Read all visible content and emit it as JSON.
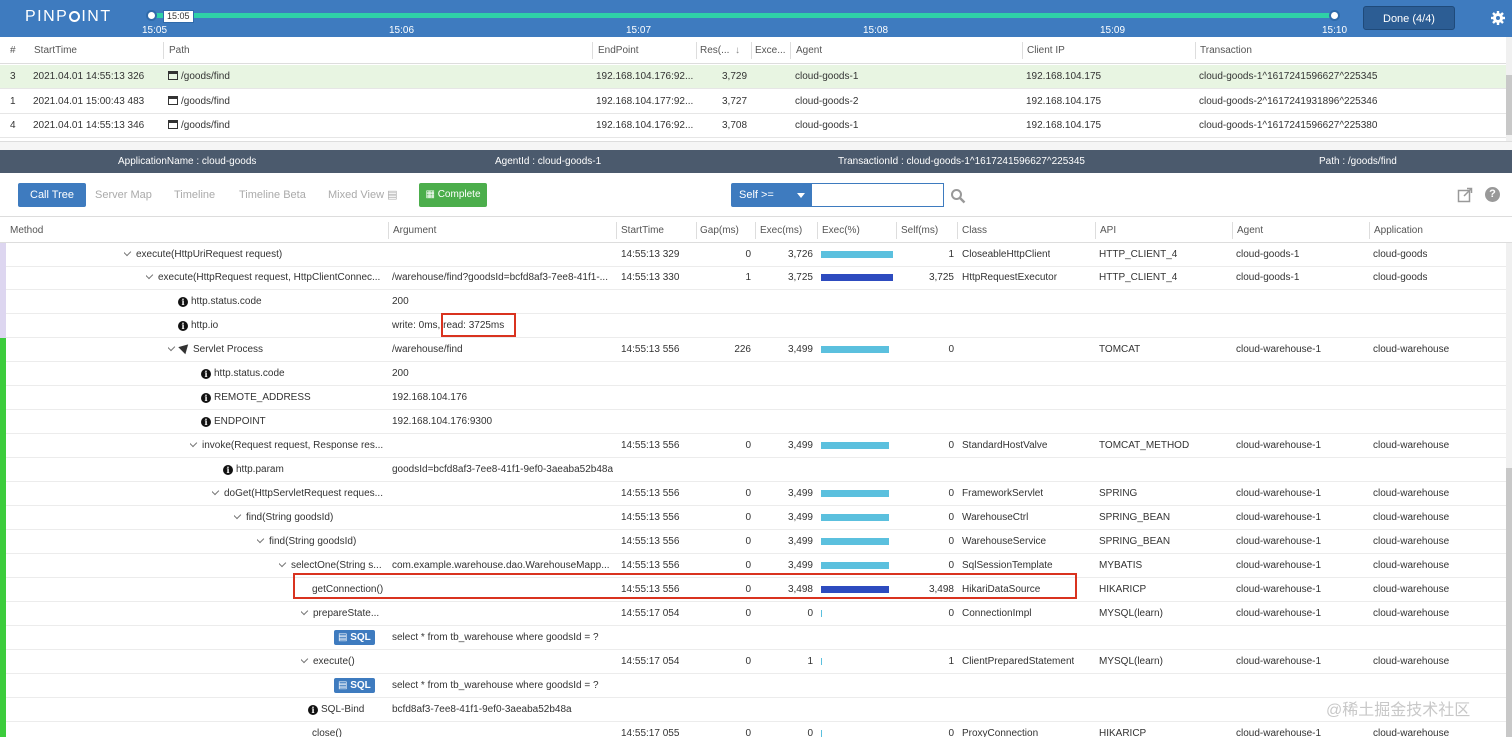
{
  "topbar": {
    "logo": [
      "PINP",
      "INT"
    ],
    "knob_time": "15:05",
    "ticks": [
      "15:05",
      "15:06",
      "15:07",
      "15:08",
      "15:09",
      "15:10"
    ],
    "done_label": "Done (4/4)"
  },
  "txlist": {
    "columns": [
      "#",
      "StartTime",
      "Path",
      "EndPoint",
      "Res(...",
      "Exce...",
      "Agent",
      "Client IP",
      "Transaction"
    ],
    "rows": [
      {
        "n": "3",
        "start": "2021.04.01 14:55:13 326",
        "path": "/goods/find",
        "endpoint": "192.168.104.176:92...",
        "res": "3,729",
        "agent": "cloud-goods-1",
        "client": "192.168.104.175",
        "tx": "cloud-goods-1^1617241596627^225345"
      },
      {
        "n": "1",
        "start": "2021.04.01 15:00:43 483",
        "path": "/goods/find",
        "endpoint": "192.168.104.177:92...",
        "res": "3,727",
        "agent": "cloud-goods-2",
        "client": "192.168.104.175",
        "tx": "cloud-goods-2^1617241931896^225346"
      },
      {
        "n": "4",
        "start": "2021.04.01 14:55:13 346",
        "path": "/goods/find",
        "endpoint": "192.168.104.176:92...",
        "res": "3,708",
        "agent": "cloud-goods-1",
        "client": "192.168.104.175",
        "tx": "cloud-goods-1^1617241596627^225380"
      }
    ]
  },
  "infobar": {
    "app": "ApplicationName : cloud-goods",
    "agent": "AgentId : cloud-goods-1",
    "tx": "TransactionId : cloud-goods-1^1617241596627^225345",
    "path": "Path : /goods/find"
  },
  "tabs": {
    "items": [
      "Call Tree",
      "Server Map",
      "Timeline",
      "Timeline Beta",
      "Mixed View"
    ],
    "complete": "Complete",
    "self_filter": "Self >="
  },
  "calltree": {
    "columns": [
      "Method",
      "Argument",
      "StartTime",
      "Gap(ms)",
      "Exec(ms)",
      "Exec(%)",
      "Self(ms)",
      "Class",
      "API",
      "Agent",
      "Application"
    ],
    "rows": [
      {
        "method": "execute(HttpUriRequest request)",
        "arg": "",
        "start": "14:55:13 329",
        "gap": "0",
        "exec": "3,726",
        "pct": 1.0,
        "self": "1",
        "cls": "CloseableHttpClient",
        "api": "HTTP_CLIENT_4",
        "agent": "cloud-goods-1",
        "app": "cloud-goods"
      },
      {
        "method": "execute(HttpRequest request, HttpClientConnec...",
        "arg": "/warehouse/find?goodsId=bcfd8af3-7ee8-41f1-...",
        "start": "14:55:13 330",
        "gap": "1",
        "exec": "3,725",
        "pct": 1.0,
        "self": "3,725",
        "cls": "HttpRequestExecutor",
        "api": "HTTP_CLIENT_4",
        "agent": "cloud-goods-1",
        "app": "cloud-goods"
      },
      {
        "method": "http.status.code",
        "arg": "200",
        "start": "",
        "gap": "",
        "exec": "",
        "pct": 0,
        "self": "",
        "cls": "",
        "api": "",
        "agent": "",
        "app": ""
      },
      {
        "method": "http.io",
        "arg": "write: 0ms, read: 3725ms",
        "start": "",
        "gap": "",
        "exec": "",
        "pct": 0,
        "self": "",
        "cls": "",
        "api": "",
        "agent": "",
        "app": ""
      },
      {
        "method": "Servlet Process",
        "arg": "/warehouse/find",
        "start": "14:55:13 556",
        "gap": "226",
        "exec": "3,499",
        "pct": 0.94,
        "self": "0",
        "cls": "",
        "api": "TOMCAT",
        "agent": "cloud-warehouse-1",
        "app": "cloud-warehouse"
      },
      {
        "method": "http.status.code",
        "arg": "200",
        "start": "",
        "gap": "",
        "exec": "",
        "pct": 0,
        "self": "",
        "cls": "",
        "api": "",
        "agent": "",
        "app": ""
      },
      {
        "method": "REMOTE_ADDRESS",
        "arg": "192.168.104.176",
        "start": "",
        "gap": "",
        "exec": "",
        "pct": 0,
        "self": "",
        "cls": "",
        "api": "",
        "agent": "",
        "app": ""
      },
      {
        "method": "ENDPOINT",
        "arg": "192.168.104.176:9300",
        "start": "",
        "gap": "",
        "exec": "",
        "pct": 0,
        "self": "",
        "cls": "",
        "api": "",
        "agent": "",
        "app": ""
      },
      {
        "method": "invoke(Request request, Response res...",
        "arg": "",
        "start": "14:55:13 556",
        "gap": "0",
        "exec": "3,499",
        "pct": 0.94,
        "self": "0",
        "cls": "StandardHostValve",
        "api": "TOMCAT_METHOD",
        "agent": "cloud-warehouse-1",
        "app": "cloud-warehouse"
      },
      {
        "method": "http.param",
        "arg": "goodsId=bcfd8af3-7ee8-41f1-9ef0-3aeaba52b48a",
        "start": "",
        "gap": "",
        "exec": "",
        "pct": 0,
        "self": "",
        "cls": "",
        "api": "",
        "agent": "",
        "app": ""
      },
      {
        "method": "doGet(HttpServletRequest reques...",
        "arg": "",
        "start": "14:55:13 556",
        "gap": "0",
        "exec": "3,499",
        "pct": 0.94,
        "self": "0",
        "cls": "FrameworkServlet",
        "api": "SPRING",
        "agent": "cloud-warehouse-1",
        "app": "cloud-warehouse"
      },
      {
        "method": "find(String goodsId)",
        "arg": "",
        "start": "14:55:13 556",
        "gap": "0",
        "exec": "3,499",
        "pct": 0.94,
        "self": "0",
        "cls": "WarehouseCtrl",
        "api": "SPRING_BEAN",
        "agent": "cloud-warehouse-1",
        "app": "cloud-warehouse"
      },
      {
        "method": "find(String goodsId)",
        "arg": "",
        "start": "14:55:13 556",
        "gap": "0",
        "exec": "3,499",
        "pct": 0.94,
        "self": "0",
        "cls": "WarehouseService",
        "api": "SPRING_BEAN",
        "agent": "cloud-warehouse-1",
        "app": "cloud-warehouse"
      },
      {
        "method": "selectOne(String s...",
        "arg": "com.example.warehouse.dao.WarehouseMapp...",
        "start": "14:55:13 556",
        "gap": "0",
        "exec": "3,499",
        "pct": 0.94,
        "self": "0",
        "cls": "SqlSessionTemplate",
        "api": "MYBATIS",
        "agent": "cloud-warehouse-1",
        "app": "cloud-warehouse"
      },
      {
        "method": "getConnection()",
        "arg": "",
        "start": "14:55:13 556",
        "gap": "0",
        "exec": "3,498",
        "pct": 0.94,
        "self": "3,498",
        "cls": "HikariDataSource",
        "api": "HIKARICP",
        "agent": "cloud-warehouse-1",
        "app": "cloud-warehouse"
      },
      {
        "method": "prepareState...",
        "arg": "",
        "start": "14:55:17 054",
        "gap": "0",
        "exec": "0",
        "pct": 0,
        "self": "0",
        "cls": "ConnectionImpl",
        "api": "MYSQL(learn)",
        "agent": "cloud-warehouse-1",
        "app": "cloud-warehouse"
      },
      {
        "method": "SQL",
        "arg": "select * from tb_warehouse where goodsId = ?",
        "start": "",
        "gap": "",
        "exec": "",
        "pct": 0,
        "self": "",
        "cls": "",
        "api": "",
        "agent": "",
        "app": ""
      },
      {
        "method": "execute()",
        "arg": "",
        "start": "14:55:17 054",
        "gap": "0",
        "exec": "1",
        "pct": 0.002,
        "self": "1",
        "cls": "ClientPreparedStatement",
        "api": "MYSQL(learn)",
        "agent": "cloud-warehouse-1",
        "app": "cloud-warehouse"
      },
      {
        "method": "SQL",
        "arg": "select * from tb_warehouse where goodsId = ?",
        "start": "",
        "gap": "",
        "exec": "",
        "pct": 0,
        "self": "",
        "cls": "",
        "api": "",
        "agent": "",
        "app": ""
      },
      {
        "method": "SQL-Bind",
        "arg": "bcfd8af3-7ee8-41f1-9ef0-3aeaba52b48a",
        "start": "",
        "gap": "",
        "exec": "",
        "pct": 0,
        "self": "",
        "cls": "",
        "api": "",
        "agent": "",
        "app": ""
      },
      {
        "method": "close()",
        "arg": "",
        "start": "14:55:17 055",
        "gap": "0",
        "exec": "0",
        "pct": 0,
        "self": "0",
        "cls": "ProxyConnection",
        "api": "HIKARICP",
        "agent": "cloud-warehouse-1",
        "app": "cloud-warehouse"
      }
    ]
  },
  "watermark": "@稀土掘金技术社区",
  "colors": {
    "accent": "#3e7bbf",
    "bar": "#5bc0de",
    "bar_self": "#2d4bbf",
    "complete": "#4cae4c",
    "highlight": "#d9331f"
  }
}
